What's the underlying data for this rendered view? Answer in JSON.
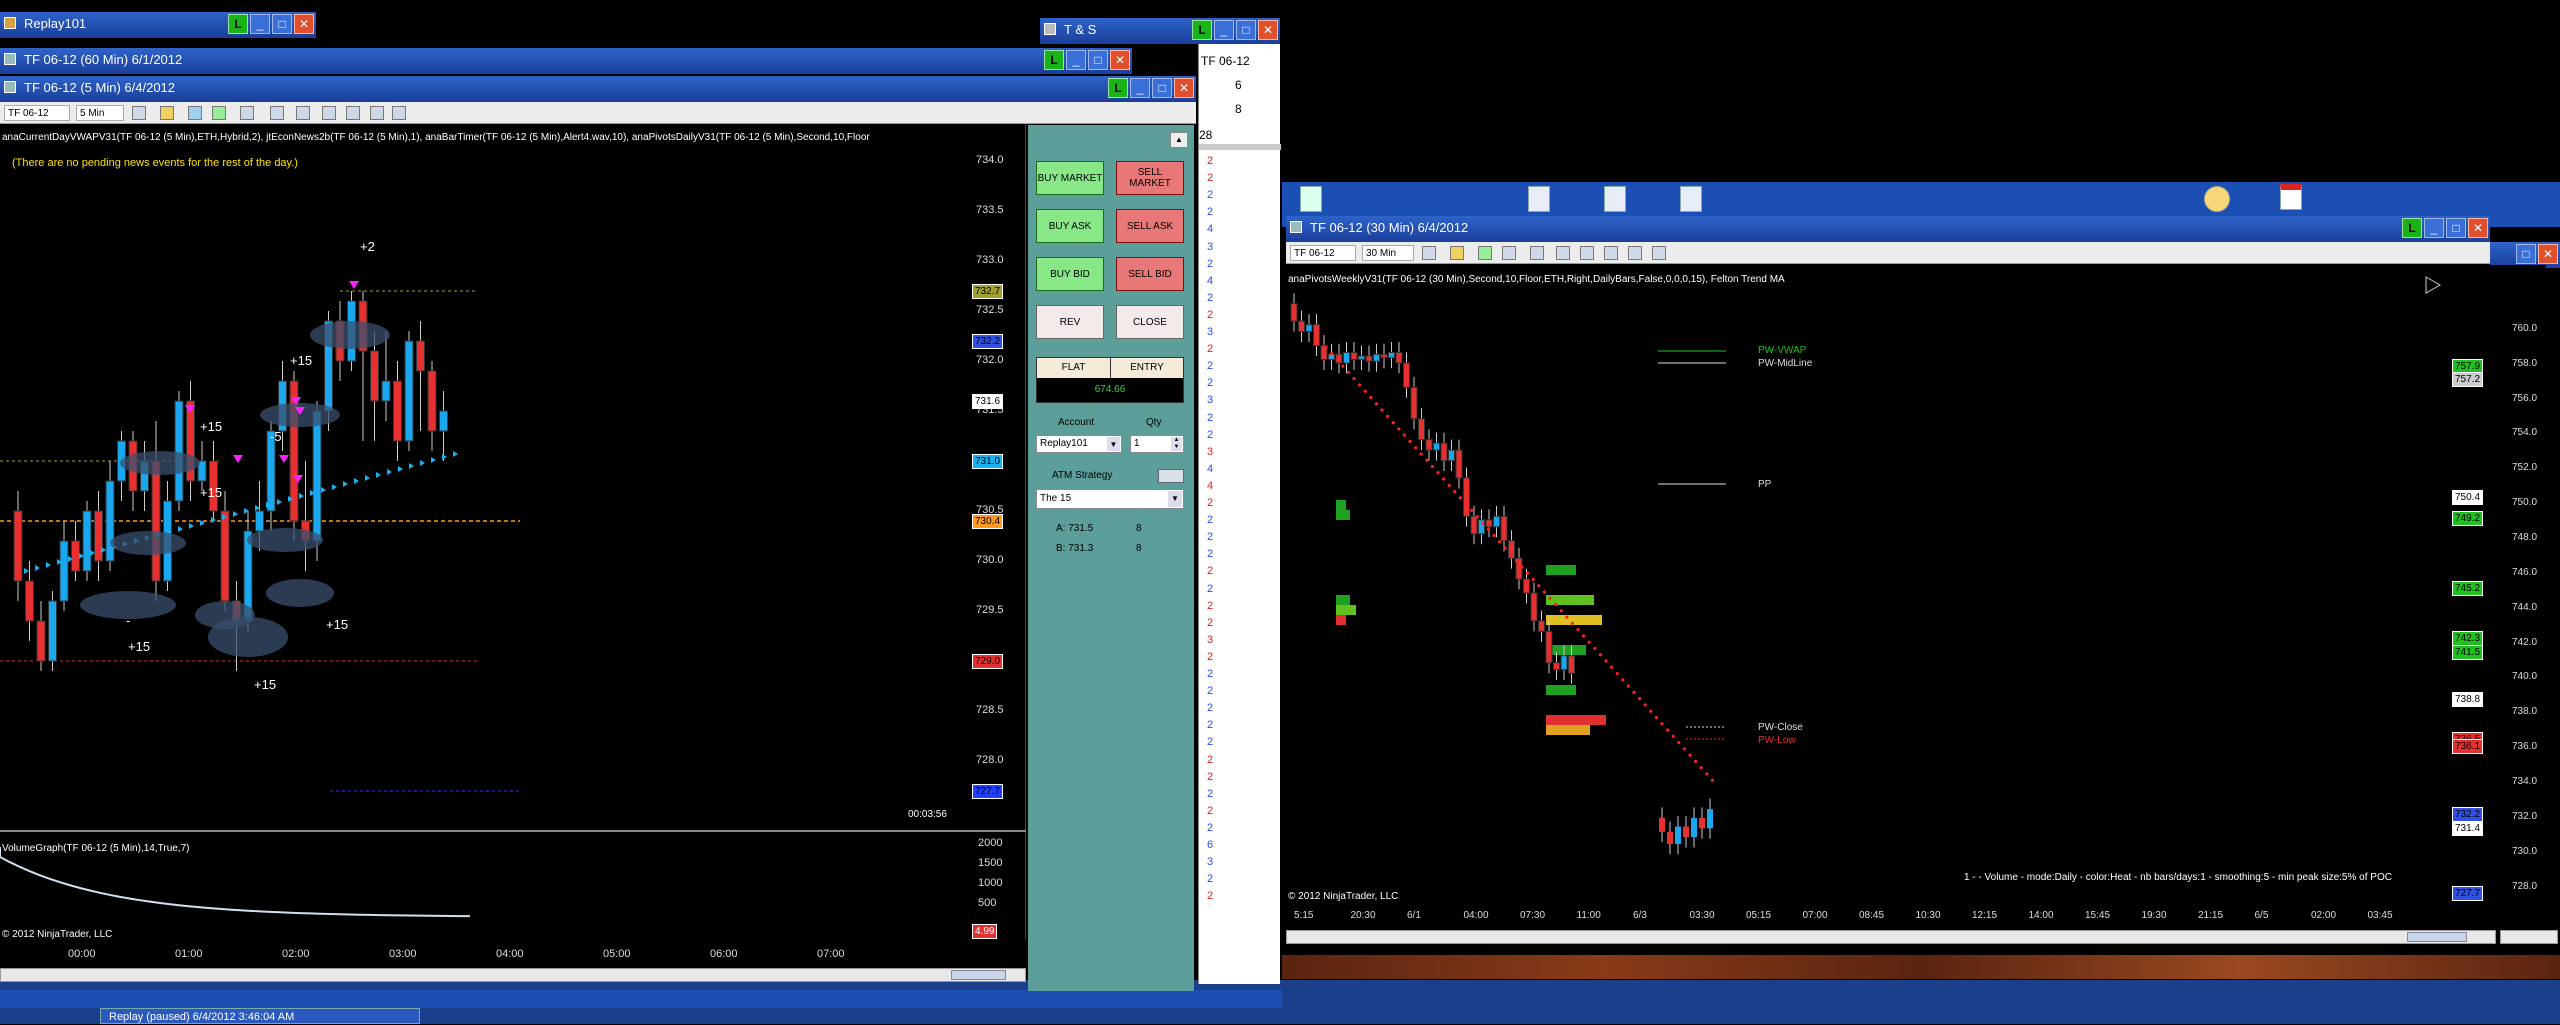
{
  "colors": {
    "buy": "#88e888",
    "sell": "#e87878",
    "bg": "#000000",
    "desktop": "#1b4fb3",
    "ema": "#ff2020",
    "vwap_dots": "#19b2f0",
    "pivot_orange": "#ff9a20"
  },
  "replay_window": {
    "title": "Replay101"
  },
  "window_60": {
    "title": "TF 06-12 (60 Min)  6/1/2012"
  },
  "window_5": {
    "title": "TF 06-12 (5 Min)  6/4/2012",
    "toolbar": {
      "instrument": "TF 06-12",
      "interval": "5 Min"
    },
    "indicators": "anaCurrentDayVWAPV31(TF 06-12 (5 Min),ETH,Hybrid,2), jtEconNews2b(TF 06-12 (5 Min),1), anaBarTimer(TF 06-12 (5 Min),Alert4.wav,10), anaPivotsDailyV31(TF 06-12 (5 Min),Second,10,Floor",
    "news": "(There are no pending news events for the rest of the day.)",
    "timer": "00:03:56",
    "volume_label": "VolumeGraph(TF 06-12 (5 Min),14,True,7)",
    "copyright": "© 2012 NinjaTrader, LLC",
    "y_ticks": [
      "734.0",
      "733.5",
      "733.0",
      "732.5",
      "732.0",
      "731.5",
      "731.0",
      "730.5",
      "730.0",
      "729.5",
      "729.0",
      "728.5",
      "728.0"
    ],
    "price_tags": [
      {
        "v": "732.7",
        "c": "#a0a030"
      },
      {
        "v": "732.2",
        "c": "#3050e0"
      },
      {
        "v": "731.6",
        "c": "#ffffff"
      },
      {
        "v": "731.0",
        "c": "#19b2f0"
      },
      {
        "v": "730.4",
        "c": "#ff9a20"
      },
      {
        "v": "729.0",
        "c": "#e03030"
      },
      {
        "v": "727.7",
        "c": "#2040ff"
      }
    ],
    "vol_ticks": [
      "2000",
      "1500",
      "1000",
      "500"
    ],
    "vol_tag": "4.99",
    "x_ticks": [
      "00:00",
      "01:00",
      "02:00",
      "03:00",
      "04:00",
      "05:00",
      "06:00",
      "07:00"
    ],
    "trade_labels": [
      "+2",
      "+15",
      "+15",
      "-5",
      "+15",
      "-",
      "+15",
      "+15",
      "+15"
    ]
  },
  "chart_trader": {
    "buy_market": "BUY MARKET",
    "sell_market": "SELL MARKET",
    "buy_ask": "BUY ASK",
    "sell_ask": "SELL ASK",
    "buy_bid": "BUY BID",
    "sell_bid": "SELL BID",
    "rev": "REV",
    "close": "CLOSE",
    "flat": "FLAT",
    "entry": "ENTRY",
    "pnl": "674.66",
    "account_label": "Account",
    "qty_label": "Qty",
    "account": "Replay101",
    "qty": "1",
    "atm_label": "ATM Strategy",
    "atm": "The 15",
    "ask": "A: 731.5",
    "ask_qty": "8",
    "bid": "B: 731.3",
    "bid_qty": "8"
  },
  "ts_window": {
    "title": "T & S",
    "instrument": "TF 06-12",
    "top_rows": [
      "6",
      "8",
      "28"
    ],
    "rows": [
      [
        "2",
        "r"
      ],
      [
        "2",
        "r"
      ],
      [
        "2",
        "b"
      ],
      [
        "2",
        "b"
      ],
      [
        "4",
        "b"
      ],
      [
        "3",
        "b"
      ],
      [
        "2",
        "b"
      ],
      [
        "4",
        "b"
      ],
      [
        "2",
        "b"
      ],
      [
        "2",
        "r"
      ],
      [
        "3",
        "b"
      ],
      [
        "2",
        "r"
      ],
      [
        "2",
        "b"
      ],
      [
        "2",
        "b"
      ],
      [
        "3",
        "b"
      ],
      [
        "2",
        "b"
      ],
      [
        "2",
        "b"
      ],
      [
        "3",
        "r"
      ],
      [
        "4",
        "b"
      ],
      [
        "4",
        "r"
      ],
      [
        "2",
        "r"
      ],
      [
        "2",
        "b"
      ],
      [
        "2",
        "b"
      ],
      [
        "2",
        "b"
      ],
      [
        "2",
        "r"
      ],
      [
        "2",
        "b"
      ],
      [
        "2",
        "r"
      ],
      [
        "2",
        "r"
      ],
      [
        "3",
        "r"
      ],
      [
        "2",
        "r"
      ],
      [
        "2",
        "b"
      ],
      [
        "2",
        "b"
      ],
      [
        "2",
        "b"
      ],
      [
        "2",
        "b"
      ],
      [
        "2",
        "b"
      ],
      [
        "2",
        "r"
      ],
      [
        "2",
        "r"
      ],
      [
        "2",
        "b"
      ],
      [
        "2",
        "r"
      ],
      [
        "2",
        "b"
      ],
      [
        "6",
        "b"
      ],
      [
        "3",
        "b"
      ],
      [
        "2",
        "b"
      ],
      [
        "2",
        "r"
      ]
    ]
  },
  "window_30": {
    "title": "TF 06-12 (30 Min)  6/4/2012",
    "toolbar": {
      "instrument": "TF 06-12",
      "interval": "30 Min"
    },
    "indicators": "anaPivotsWeeklyV31(TF 06-12 (30 Min),Second,10,Floor,ETH,Right,DailyBars,False,0,0,0,15), Felton Trend MA",
    "labels": {
      "pw_vwap": "PW-VWAP",
      "pw_mid": "PW-MidLine",
      "pp": "PP",
      "pw_close": "PW-Close",
      "pw_low": "PW-Low"
    },
    "volume_note": "1 -  - Volume - mode:Daily - color:Heat - nb bars/days:1 - smoothing:5 - min peak size:5% of POC",
    "copyright": "© 2012 NinjaTrader, LLC",
    "y_ticks": [
      "760.0",
      "758.0",
      "756.0",
      "754.0",
      "752.0",
      "750.0",
      "748.0",
      "746.0",
      "744.0",
      "742.0",
      "740.0",
      "738.0",
      "736.0",
      "734.0",
      "732.0",
      "730.0",
      "728.0"
    ],
    "y_ticks_right": [
      "752.0",
      "750.0",
      "748.0",
      "746.0",
      "744.0",
      "742.0",
      "740.0",
      "738.0",
      "736.0",
      "734.0",
      "732.0",
      "730.0",
      "728.0"
    ],
    "price_tags": [
      {
        "v": "757.9",
        "c": "#20c020"
      },
      {
        "v": "757.2",
        "c": "#cccccc"
      },
      {
        "v": "749.2",
        "c": "#20c020"
      },
      {
        "v": "745.2",
        "c": "#20c020"
      },
      {
        "v": "750.4",
        "c": "#ffffff"
      },
      {
        "v": "742.3",
        "c": "#20c020"
      },
      {
        "v": "741.5",
        "c": "#20c020"
      },
      {
        "v": "736.5",
        "c": "#e03030"
      },
      {
        "v": "738.8",
        "c": "#ffffff"
      },
      {
        "v": "736.1",
        "c": "#e03030"
      },
      {
        "v": "732.2",
        "c": "#3050e0"
      },
      {
        "v": "731.4",
        "c": "#ffffff"
      },
      {
        "v": "727.7",
        "c": "#3050e0"
      }
    ],
    "x_ticks": [
      "5:15",
      "20:30",
      "6/1",
      "04:00",
      "07:30",
      "11:00",
      "6/3",
      "03:30",
      "05:15",
      "07:00",
      "08:45",
      "10:30",
      "12:15",
      "14:00",
      "15:45",
      "19:30",
      "21:15",
      "6/5",
      "02:00",
      "03:45"
    ]
  },
  "taskbar": {
    "replay_status": "Replay (paused) 6/4/2012 3:46:04 AM"
  }
}
